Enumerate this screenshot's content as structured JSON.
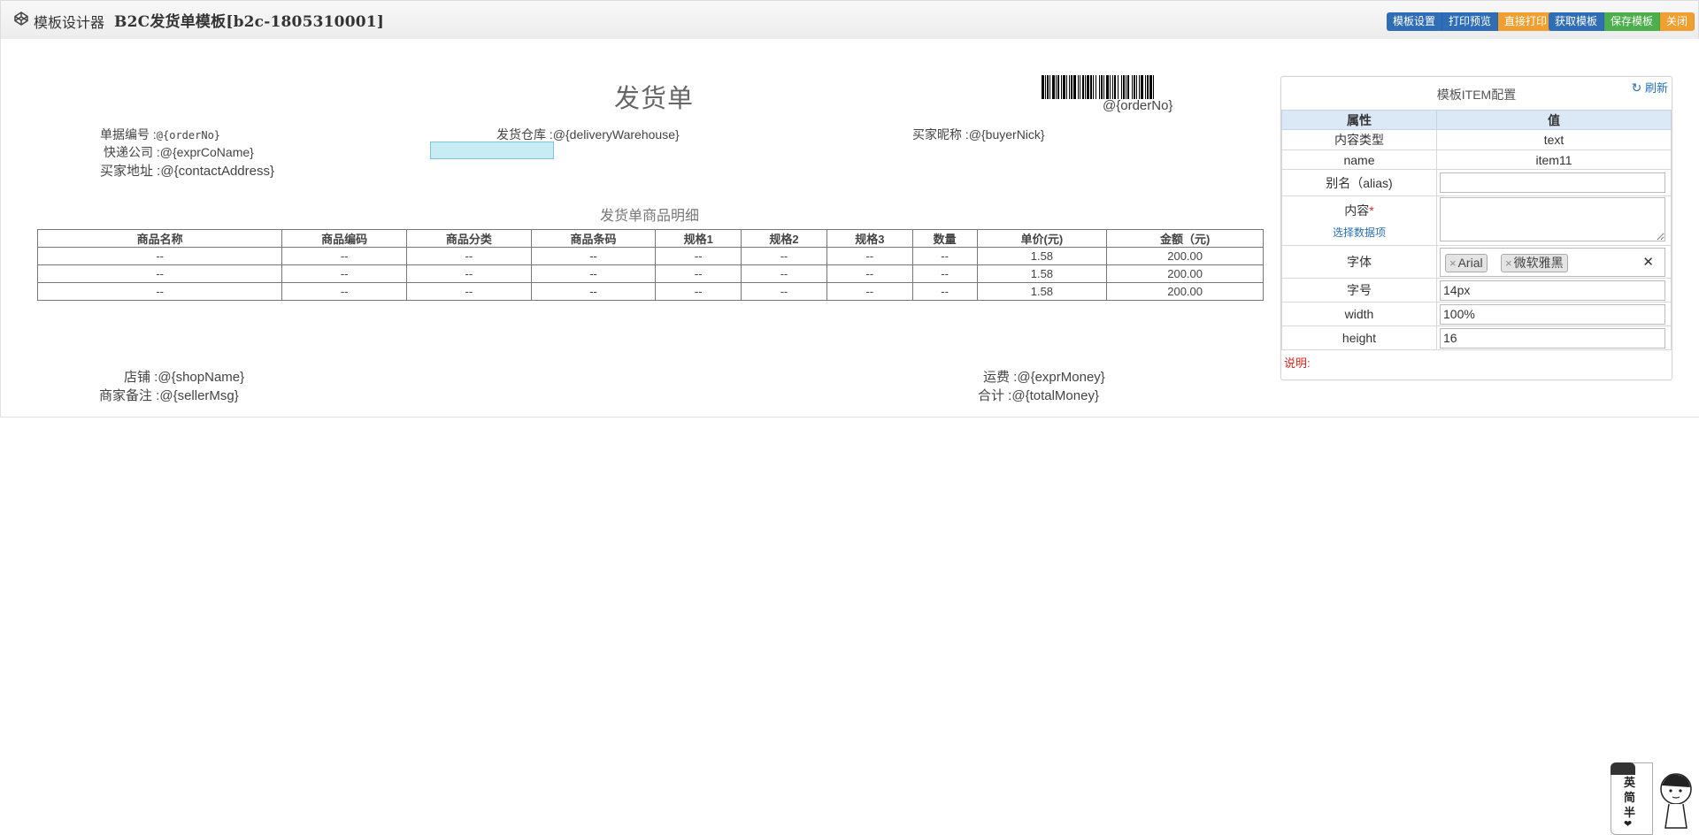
{
  "header": {
    "app_name": "模板设计器",
    "doc_name": "B2C发货单模板[b2c-1805310001]",
    "buttons_group1": [
      {
        "label": "模板设置",
        "color": "#2f6db5"
      },
      {
        "label": "打印预览",
        "color": "#2f6db5"
      },
      {
        "label": "直接打印",
        "color": "#f0a030"
      }
    ],
    "buttons_group2": [
      {
        "label": "获取模板",
        "color": "#2f6db5"
      },
      {
        "label": "保存模板",
        "color": "#4cae4c"
      },
      {
        "label": "关闭",
        "color": "#f0a030"
      }
    ]
  },
  "canvas": {
    "title": "发货单",
    "barcode_label": "@{orderNo}",
    "fields": {
      "order_no": {
        "label": "单据编号 :",
        "value": "@{orderNo}"
      },
      "warehouse": {
        "label": "发货仓库 :",
        "value": "@{deliveryWarehouse}"
      },
      "buyer_nick": {
        "label": "买家昵称 :",
        "value": "@{buyerNick}"
      },
      "express": {
        "label": "快递公司 :",
        "value": "@{exprCoName}"
      },
      "address": {
        "label": "买家地址 :",
        "value": "@{contactAddress}"
      },
      "shop": {
        "label": "店铺 :",
        "value": "@{shopName}"
      },
      "seller_msg": {
        "label": "商家备注 :",
        "value": "@{sellerMsg}"
      },
      "freight": {
        "label": "运费 :",
        "value": "@{exprMoney}"
      },
      "total": {
        "label": "合计 :",
        "value": "@{totalMoney}"
      }
    },
    "table_title": "发货单商品明细",
    "table": {
      "columns": [
        "商品名称",
        "商品编码",
        "商品分类",
        "商品条码",
        "规格1",
        "规格2",
        "规格3",
        "数量",
        "单价(元)",
        "金额（元)"
      ],
      "rows": [
        [
          "--",
          "--",
          "--",
          "--",
          "--",
          "--",
          "--",
          "--",
          "1.58",
          "200.00"
        ],
        [
          "--",
          "--",
          "--",
          "--",
          "--",
          "--",
          "--",
          "--",
          "1.58",
          "200.00"
        ],
        [
          "--",
          "--",
          "--",
          "--",
          "--",
          "--",
          "--",
          "--",
          "1.58",
          "200.00"
        ]
      ]
    }
  },
  "panel": {
    "title": "模板ITEM配置",
    "refresh_label": "刷新",
    "header_attr": "属性",
    "header_value": "值",
    "content_type_label": "内容类型",
    "content_type_value": "text",
    "name_label": "name",
    "name_value": "item11",
    "alias_label": "别名（alias)",
    "alias_value": "",
    "content_label": "内容",
    "required_mark": "*",
    "select_data_link": "选择数据项",
    "font_label": "字体",
    "font_tags": [
      "Arial",
      "微软雅黑"
    ],
    "font_size_label": "字号",
    "font_size_value": "14px",
    "width_label": "width",
    "width_value": "100%",
    "height_label": "height",
    "height_value": "16",
    "note_label": "说明:"
  },
  "ime": {
    "chars": [
      "英",
      "简",
      "半",
      "❤"
    ]
  }
}
